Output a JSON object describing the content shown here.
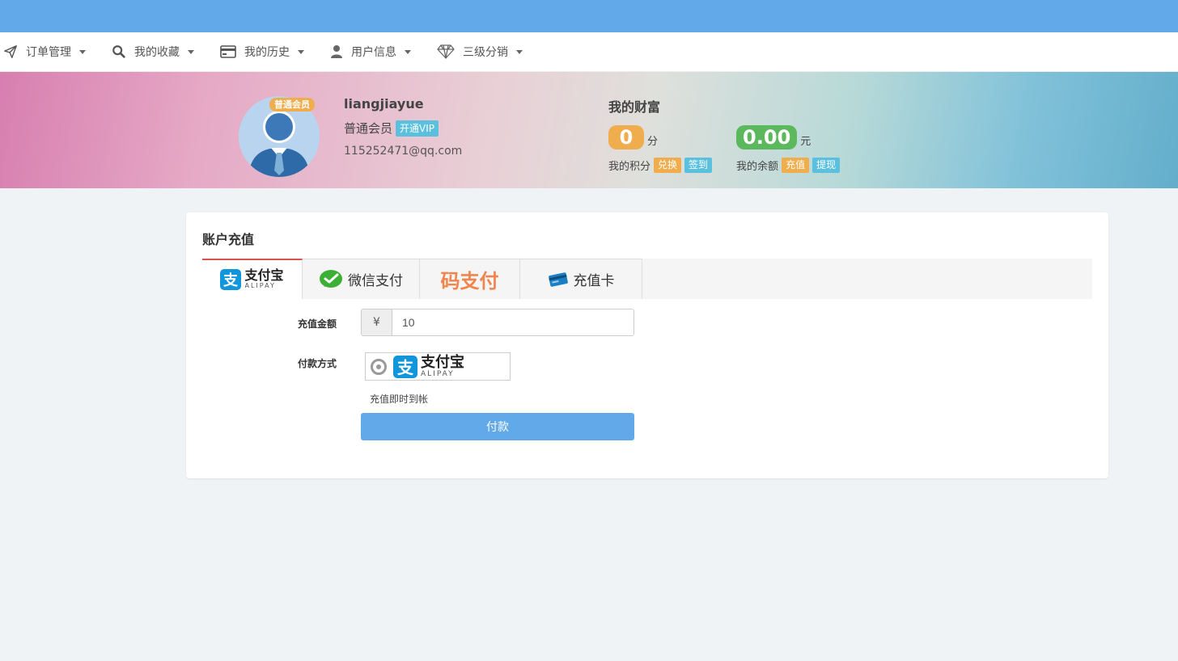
{
  "nav": {
    "items": [
      {
        "label": "订单管理",
        "icon": "paper-plane-icon"
      },
      {
        "label": "我的收藏",
        "icon": "search-icon"
      },
      {
        "label": "我的历史",
        "icon": "credit-card-icon"
      },
      {
        "label": "用户信息",
        "icon": "user-icon"
      },
      {
        "label": "三级分销",
        "icon": "diamond-icon"
      }
    ]
  },
  "profile": {
    "badge": "普通会员",
    "username": "liangjiayue",
    "level": "普通会员",
    "vip_button": "开通VIP",
    "email": "115252471@qq.com"
  },
  "wealth": {
    "title": "我的财富",
    "points": {
      "value": "0",
      "unit": "分",
      "label": "我的积分",
      "btn1": "兑换",
      "btn2": "签到"
    },
    "balance": {
      "value": "0.00",
      "unit": "元",
      "label": "我的余额",
      "btn1": "充值",
      "btn2": "提现"
    }
  },
  "recharge": {
    "title": "账户充值",
    "tabs": {
      "alipay_cn": "支付宝",
      "alipay_en": "ALIPAY",
      "wechat": "微信支付",
      "code": "码支付",
      "card": "充值卡"
    },
    "amount_label": "充值金额",
    "currency": "¥",
    "amount_value": "10",
    "method_label": "付款方式",
    "method_cn": "支付宝",
    "method_en": "ALIPAY",
    "note": "充值即时到帐",
    "pay_button": "付款"
  },
  "colors": {
    "topbar": "#62a9ea",
    "orange": "#f0ad4e",
    "green": "#5cb85c",
    "info": "#5bc0de",
    "alipay_blue": "#1296db",
    "wechat_green": "#3cb034"
  }
}
